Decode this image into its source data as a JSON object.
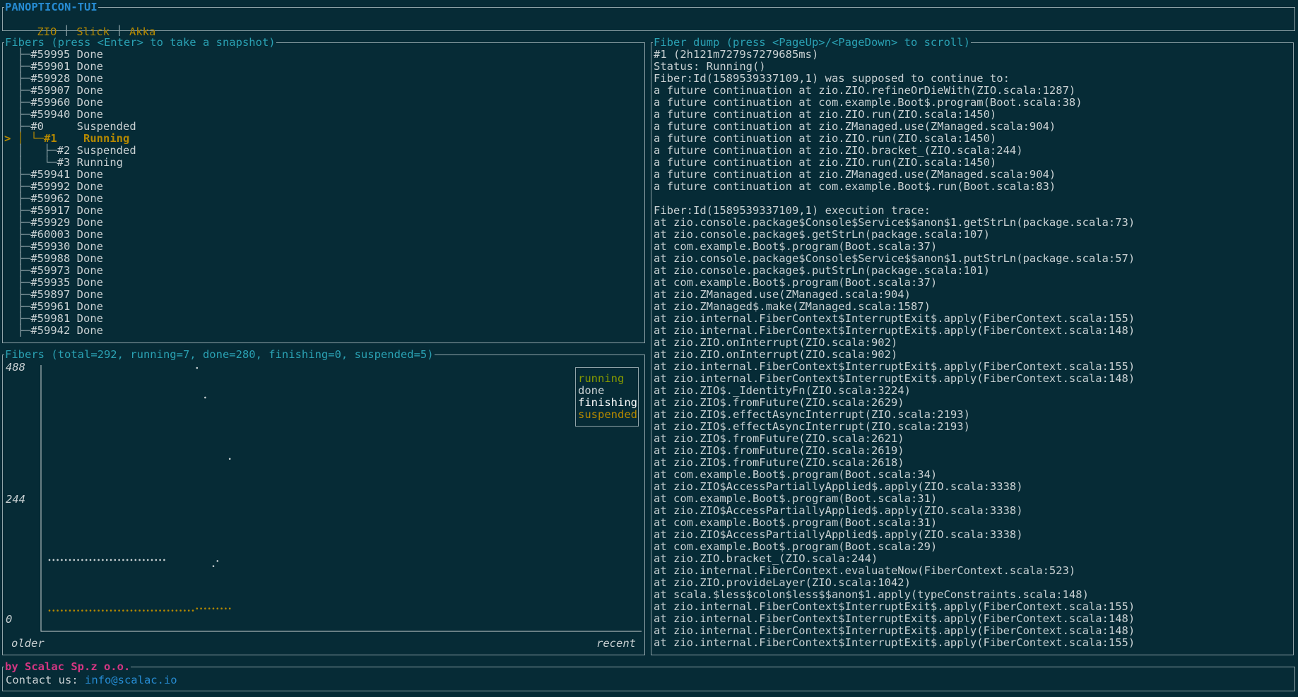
{
  "app": {
    "title": "PANOPTICON-TUI"
  },
  "tabs": [
    {
      "label": "ZIO"
    },
    {
      "label": "Slick"
    },
    {
      "label": "Akka"
    }
  ],
  "fibers_panel": {
    "title": "Fibers (press <Enter> to take a snapshot)",
    "items": [
      {
        "prefix": "  ├─",
        "id": "#59995",
        "status": "Done",
        "selected": false
      },
      {
        "prefix": "  ├─",
        "id": "#59901",
        "status": "Done",
        "selected": false
      },
      {
        "prefix": "  ├─",
        "id": "#59928",
        "status": "Done",
        "selected": false
      },
      {
        "prefix": "  ├─",
        "id": "#59907",
        "status": "Done",
        "selected": false
      },
      {
        "prefix": "  ├─",
        "id": "#59960",
        "status": "Done",
        "selected": false
      },
      {
        "prefix": "  ├─",
        "id": "#59940",
        "status": "Done",
        "selected": false
      },
      {
        "prefix": "  ├─",
        "id": "#0    ",
        "status": "Suspended",
        "selected": false
      },
      {
        "prefix": "> │ └─",
        "id": "#1   ",
        "status": "Running",
        "selected": true
      },
      {
        "prefix": "  │   ├─",
        "id": "#2",
        "status": "Suspended",
        "selected": false
      },
      {
        "prefix": "  │   └─",
        "id": "#3",
        "status": "Running",
        "selected": false
      },
      {
        "prefix": "  ├─",
        "id": "#59941",
        "status": "Done",
        "selected": false
      },
      {
        "prefix": "  ├─",
        "id": "#59992",
        "status": "Done",
        "selected": false
      },
      {
        "prefix": "  ├─",
        "id": "#59962",
        "status": "Done",
        "selected": false
      },
      {
        "prefix": "  ├─",
        "id": "#59917",
        "status": "Done",
        "selected": false
      },
      {
        "prefix": "  ├─",
        "id": "#59929",
        "status": "Done",
        "selected": false
      },
      {
        "prefix": "  ├─",
        "id": "#60003",
        "status": "Done",
        "selected": false
      },
      {
        "prefix": "  ├─",
        "id": "#59930",
        "status": "Done",
        "selected": false
      },
      {
        "prefix": "  ├─",
        "id": "#59988",
        "status": "Done",
        "selected": false
      },
      {
        "prefix": "  ├─",
        "id": "#59973",
        "status": "Done",
        "selected": false
      },
      {
        "prefix": "  ├─",
        "id": "#59935",
        "status": "Done",
        "selected": false
      },
      {
        "prefix": "  ├─",
        "id": "#59897",
        "status": "Done",
        "selected": false
      },
      {
        "prefix": "  ├─",
        "id": "#59961",
        "status": "Done",
        "selected": false
      },
      {
        "prefix": "  ├─",
        "id": "#59981",
        "status": "Done",
        "selected": false
      },
      {
        "prefix": "  ├─",
        "id": "#59942",
        "status": "Done",
        "selected": false
      }
    ]
  },
  "chart_panel": {
    "title": "Fibers (total=292, running=7, done=280, finishing=0, suspended=5)"
  },
  "chart_data": {
    "type": "scatter",
    "y_ticks": [
      "488",
      "244",
      "0"
    ],
    "ylim": [
      0,
      488
    ],
    "x_labels": {
      "left": "older",
      "right": "recent"
    },
    "colors": {
      "running": "#859900",
      "done": "#c9d1d3",
      "finishing": "#ffffff",
      "suspended": "#b58900"
    },
    "series": [
      {
        "name": "running",
        "values": []
      },
      {
        "name": "done",
        "values": [
          [
            0,
            112
          ],
          [
            1,
            112
          ],
          [
            2,
            112
          ],
          [
            3,
            112
          ],
          [
            4,
            112
          ],
          [
            5,
            112
          ],
          [
            6,
            112
          ],
          [
            7,
            112
          ],
          [
            8,
            112
          ],
          [
            9,
            112
          ],
          [
            10,
            112
          ],
          [
            11,
            112
          ],
          [
            12,
            112
          ],
          [
            13,
            112
          ],
          [
            14,
            112
          ],
          [
            15,
            112
          ],
          [
            16,
            112
          ],
          [
            17,
            112
          ],
          [
            18,
            112
          ],
          [
            19,
            112
          ],
          [
            20,
            112
          ],
          [
            21,
            112
          ],
          [
            22,
            112
          ],
          [
            23,
            112
          ],
          [
            24,
            112
          ],
          [
            25,
            112
          ],
          [
            26,
            112
          ],
          [
            27,
            112
          ],
          [
            28,
            112
          ],
          [
            36,
            488
          ],
          [
            38,
            430
          ],
          [
            40,
            100
          ],
          [
            41,
            110
          ],
          [
            44,
            310
          ]
        ]
      },
      {
        "name": "finishing",
        "values": []
      },
      {
        "name": "suspended",
        "values": [
          [
            0,
            13
          ],
          [
            1,
            13
          ],
          [
            2,
            13
          ],
          [
            3,
            13
          ],
          [
            4,
            13
          ],
          [
            5,
            13
          ],
          [
            6,
            13
          ],
          [
            7,
            13
          ],
          [
            8,
            13
          ],
          [
            9,
            13
          ],
          [
            10,
            13
          ],
          [
            11,
            13
          ],
          [
            12,
            13
          ],
          [
            13,
            13
          ],
          [
            14,
            13
          ],
          [
            15,
            13
          ],
          [
            16,
            13
          ],
          [
            17,
            13
          ],
          [
            18,
            13
          ],
          [
            19,
            13
          ],
          [
            20,
            13
          ],
          [
            21,
            13
          ],
          [
            22,
            13
          ],
          [
            23,
            13
          ],
          [
            24,
            13
          ],
          [
            25,
            13
          ],
          [
            26,
            13
          ],
          [
            27,
            13
          ],
          [
            28,
            13
          ],
          [
            29,
            13
          ],
          [
            30,
            13
          ],
          [
            31,
            13
          ],
          [
            32,
            13
          ],
          [
            33,
            13
          ],
          [
            34,
            13
          ],
          [
            35,
            13
          ],
          [
            36,
            17
          ],
          [
            37,
            17
          ],
          [
            38,
            17
          ],
          [
            39,
            17
          ],
          [
            40,
            17
          ],
          [
            41,
            17
          ],
          [
            42,
            17
          ],
          [
            43,
            17
          ],
          [
            44,
            17
          ]
        ]
      }
    ]
  },
  "dump_panel": {
    "title": "Fiber dump (press <PageUp>/<PageDown> to scroll)",
    "lines": [
      "#1 (2h121m7279s7279685ms)",
      "Status: Running()",
      "Fiber:Id(1589539337109,1) was supposed to continue to:",
      "a future continuation at zio.ZIO.refineOrDieWith(ZIO.scala:1287)",
      "a future continuation at com.example.Boot$.program(Boot.scala:38)",
      "a future continuation at zio.ZIO.run(ZIO.scala:1450)",
      "a future continuation at zio.ZManaged.use(ZManaged.scala:904)",
      "a future continuation at zio.ZIO.run(ZIO.scala:1450)",
      "a future continuation at zio.ZIO.bracket_(ZIO.scala:244)",
      "a future continuation at zio.ZIO.run(ZIO.scala:1450)",
      "a future continuation at zio.ZManaged.use(ZManaged.scala:904)",
      "a future continuation at com.example.Boot$.run(Boot.scala:83)",
      "",
      "Fiber:Id(1589539337109,1) execution trace:",
      "at zio.console.package$Console$Service$$anon$1.getStrLn(package.scala:73)",
      "at zio.console.package$.getStrLn(package.scala:107)",
      "at com.example.Boot$.program(Boot.scala:37)",
      "at zio.console.package$Console$Service$$anon$1.putStrLn(package.scala:57)",
      "at zio.console.package$.putStrLn(package.scala:101)",
      "at com.example.Boot$.program(Boot.scala:37)",
      "at zio.ZManaged.use(ZManaged.scala:904)",
      "at zio.ZManaged$.make(ZManaged.scala:1587)",
      "at zio.internal.FiberContext$InterruptExit$.apply(FiberContext.scala:155)",
      "at zio.internal.FiberContext$InterruptExit$.apply(FiberContext.scala:148)",
      "at zio.ZIO.onInterrupt(ZIO.scala:902)",
      "at zio.ZIO.onInterrupt(ZIO.scala:902)",
      "at zio.internal.FiberContext$InterruptExit$.apply(FiberContext.scala:155)",
      "at zio.internal.FiberContext$InterruptExit$.apply(FiberContext.scala:148)",
      "at zio.ZIO$._IdentityFn(ZIO.scala:3224)",
      "at zio.ZIO$.fromFuture(ZIO.scala:2629)",
      "at zio.ZIO$.effectAsyncInterrupt(ZIO.scala:2193)",
      "at zio.ZIO$.effectAsyncInterrupt(ZIO.scala:2193)",
      "at zio.ZIO$.fromFuture(ZIO.scala:2621)",
      "at zio.ZIO$.fromFuture(ZIO.scala:2619)",
      "at zio.ZIO$.fromFuture(ZIO.scala:2618)",
      "at com.example.Boot$.program(Boot.scala:34)",
      "at zio.ZIO$AccessPartiallyApplied$.apply(ZIO.scala:3338)",
      "at com.example.Boot$.program(Boot.scala:31)",
      "at zio.ZIO$AccessPartiallyApplied$.apply(ZIO.scala:3338)",
      "at com.example.Boot$.program(Boot.scala:31)",
      "at zio.ZIO$AccessPartiallyApplied$.apply(ZIO.scala:3338)",
      "at com.example.Boot$.program(Boot.scala:29)",
      "at zio.ZIO.bracket_(ZIO.scala:244)",
      "at zio.internal.FiberContext.evaluateNow(FiberContext.scala:523)",
      "at zio.ZIO.provideLayer(ZIO.scala:1042)",
      "at scala.$less$colon$less$$anon$1.apply(typeConstraints.scala:148)",
      "at zio.internal.FiberContext$InterruptExit$.apply(FiberContext.scala:155)",
      "at zio.internal.FiberContext$InterruptExit$.apply(FiberContext.scala:148)",
      "at zio.internal.FiberContext$InterruptExit$.apply(FiberContext.scala:148)",
      "at zio.internal.FiberContext$InterruptExit$.apply(FiberContext.scala:155)"
    ]
  },
  "footer": {
    "title": "by Scalac Sp.z o.o.",
    "contact_label": "Contact us: ",
    "contact_email": "info@scalac.io"
  }
}
